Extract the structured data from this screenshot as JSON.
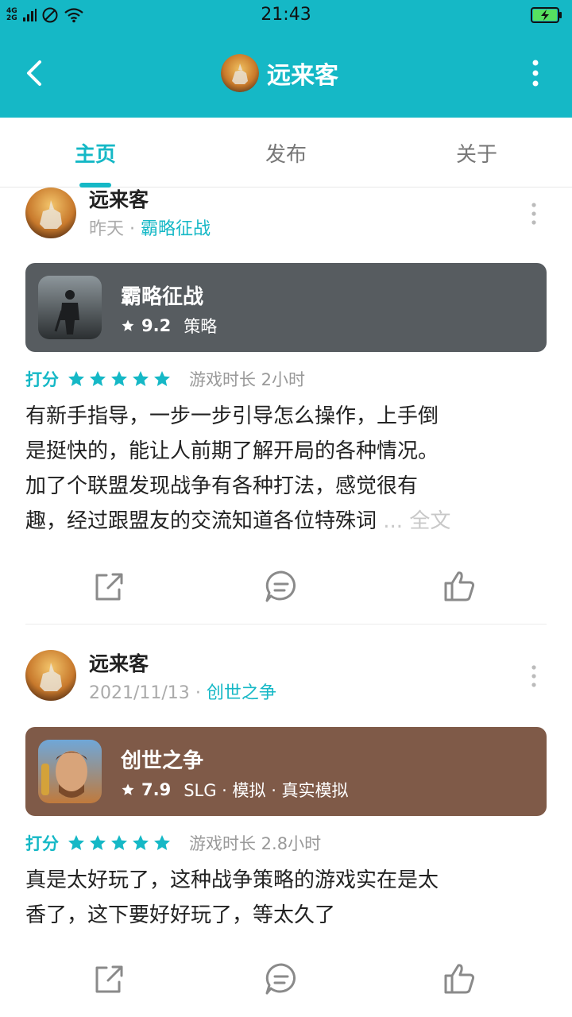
{
  "status_bar": {
    "net_top": "4G",
    "net_bottom": "2G",
    "time": "21:43"
  },
  "header": {
    "title": "远来客",
    "icons": {
      "back": "back-chevron-icon",
      "more": "more-vertical-icon"
    }
  },
  "tabs": [
    {
      "label": "主页",
      "active": true
    },
    {
      "label": "发布",
      "active": false
    },
    {
      "label": "关于",
      "active": false
    }
  ],
  "colors": {
    "accent": "#15b8c6",
    "card1_bg": "#575c60",
    "card2_bg": "#7f5a48"
  },
  "posts": [
    {
      "author": "远来客",
      "date": "昨天",
      "sep": "·",
      "game_link": "霸略征战",
      "game": {
        "name": "霸略征战",
        "score": "9.2",
        "tags": "策略"
      },
      "rating_label": "打分",
      "stars": 5,
      "playtime": "游戏时长 2小时",
      "text_lines": [
        "有新手指导，一步一步引导怎么操作，上手倒",
        "是挺快的，能让人前期了解开局的各种情况。",
        "加了个联盟发现战争有各种打法，感觉很有",
        "趣，经过跟盟友的交流知道各位特殊词"
      ],
      "ellipsis": "...",
      "more_label": "全文"
    },
    {
      "author": "远来客",
      "date": "2021/11/13",
      "sep": "·",
      "game_link": "创世之争",
      "game": {
        "name": "创世之争",
        "score": "7.9",
        "tags": "SLG · 模拟 · 真实模拟"
      },
      "rating_label": "打分",
      "stars": 5,
      "playtime": "游戏时长 2.8小时",
      "text_lines": [
        "真是太好玩了，这种战争策略的游戏实在是太",
        "香了，这下要好好玩了，等太久了"
      ]
    }
  ]
}
